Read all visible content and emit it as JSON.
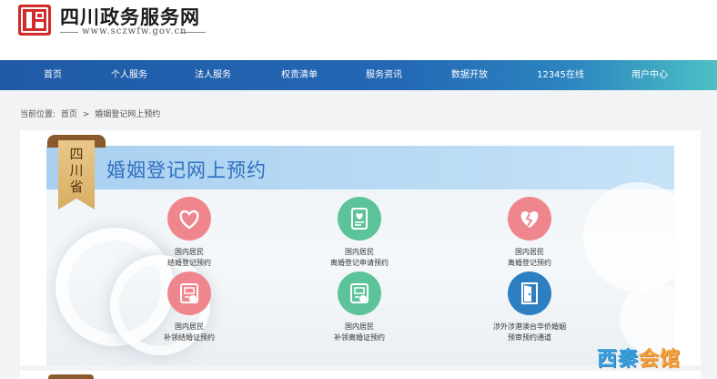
{
  "header": {
    "logo_text": "四川",
    "site_title": "四川政务服务网",
    "site_url": "www.sczwfw.gov.cn"
  },
  "nav": {
    "items": [
      {
        "label": "首页"
      },
      {
        "label": "个人服务"
      },
      {
        "label": "法人服务"
      },
      {
        "label": "权责清单"
      },
      {
        "label": "服务资讯"
      },
      {
        "label": "数据开放"
      },
      {
        "label": "12345在线"
      },
      {
        "label": "用户中心"
      }
    ]
  },
  "breadcrumb": {
    "prefix": "当前位置:",
    "home": "首页",
    "separator": ">",
    "current": "婚姻登记网上预约"
  },
  "banner": {
    "ribbon_line1": "四",
    "ribbon_line2": "川",
    "ribbon_line3": "省",
    "title": "婚姻登记网上预约"
  },
  "services": [
    {
      "line1": "国内居民",
      "line2": "结婚登记预约",
      "icon": "heart-icon",
      "color": "#f0868d"
    },
    {
      "line1": "国内居民",
      "line2": "离婚登记申请预约",
      "icon": "document-heart-icon",
      "color": "#5cc39a"
    },
    {
      "line1": "国内居民",
      "line2": "离婚登记预约",
      "icon": "broken-heart-icon",
      "color": "#f0868d"
    },
    {
      "line1": "国内居民",
      "line2": "补领结婚证预约",
      "icon": "certificate-icon",
      "color": "#f0868d"
    },
    {
      "line1": "国内居民",
      "line2": "补领离婚证预约",
      "icon": "certificate-icon",
      "color": "#5cc39a"
    },
    {
      "line1": "涉外涉港澳台华侨婚姻",
      "line2": "预审预约通道",
      "icon": "door-icon",
      "color": "#2d7fc1"
    }
  ],
  "watermark": {
    "part1": "西",
    "part2": "秦",
    "part3": "会馆"
  }
}
